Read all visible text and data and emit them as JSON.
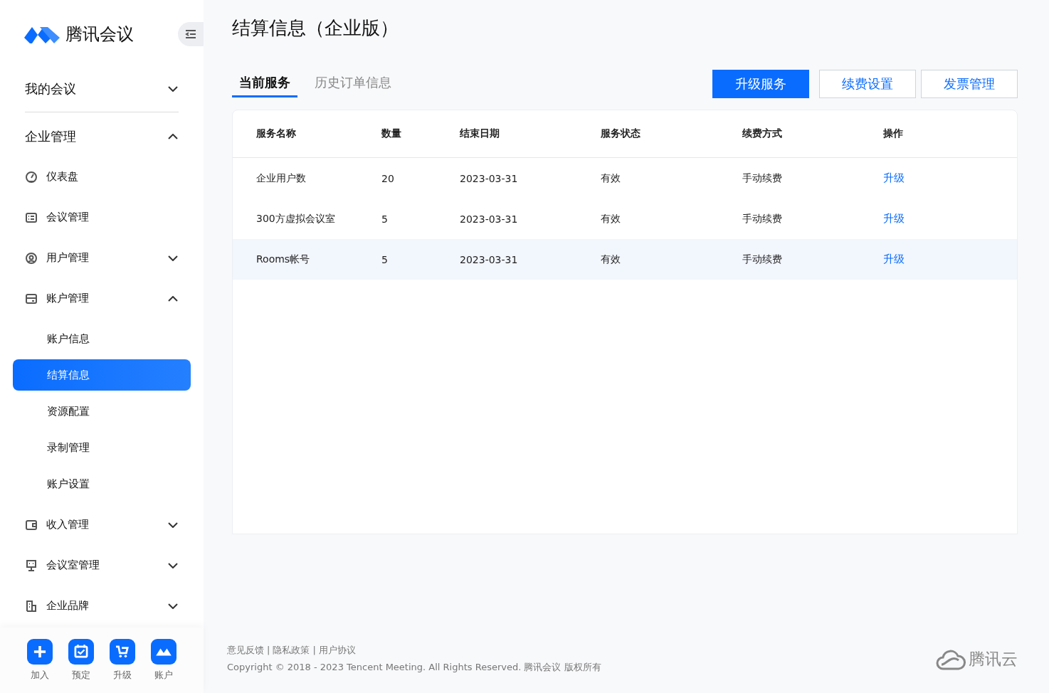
{
  "sidebar": {
    "logo_text": "腾讯会议",
    "nav": [
      {
        "label": "我的会议",
        "expanded": false
      },
      {
        "label": "企业管理",
        "expanded": true,
        "children": [
          {
            "label": "仪表盘"
          },
          {
            "label": "会议管理"
          },
          {
            "label": "用户管理",
            "expanded": false
          },
          {
            "label": "账户管理",
            "expanded": true,
            "children": [
              {
                "label": "账户信息",
                "selected": false
              },
              {
                "label": "结算信息",
                "selected": true
              },
              {
                "label": "资源配置",
                "selected": false
              },
              {
                "label": "录制管理",
                "selected": false
              },
              {
                "label": "账户设置",
                "selected": false
              }
            ]
          },
          {
            "label": "收入管理",
            "expanded": false
          },
          {
            "label": "会议室管理",
            "expanded": false
          },
          {
            "label": "企业品牌",
            "expanded": false
          }
        ]
      }
    ],
    "dock": [
      {
        "label": "加入"
      },
      {
        "label": "预定"
      },
      {
        "label": "升级"
      },
      {
        "label": "账户"
      }
    ]
  },
  "page_title": "结算信息（企业版）",
  "tabs": [
    {
      "label": "当前服务",
      "selected": true
    },
    {
      "label": "历史订单信息",
      "selected": false
    }
  ],
  "buttons": [
    {
      "label": "升级服务",
      "kind": "primary"
    },
    {
      "label": "续费设置",
      "kind": "outline"
    },
    {
      "label": "发票管理",
      "kind": "outline"
    }
  ],
  "table": {
    "columns": [
      "服务名称",
      "数量",
      "结束日期",
      "服务状态",
      "续费方式",
      "操作"
    ],
    "rows": [
      {
        "cells": [
          "企业用户数",
          "20",
          "2023-03-31",
          "有效",
          "手动续费"
        ],
        "action": "升级",
        "hovered": false
      },
      {
        "cells": [
          "300方虚拟会议室",
          "5",
          "2023-03-31",
          "有效",
          "手动续费"
        ],
        "action": "升级",
        "hovered": false
      },
      {
        "cells": [
          "Rooms帐号",
          "5",
          "2023-03-31",
          "有效",
          "手动续费"
        ],
        "action": "升级",
        "hovered": true
      }
    ]
  },
  "footer": {
    "links": [
      "意见反馈",
      "隐私政策",
      "用户协议"
    ],
    "separator": "|",
    "copyright": "Copyright © 2018 - 2023 Tencent Meeting. All Rights Reserved. 腾讯会议 版权所有",
    "brand": "腾讯云"
  }
}
